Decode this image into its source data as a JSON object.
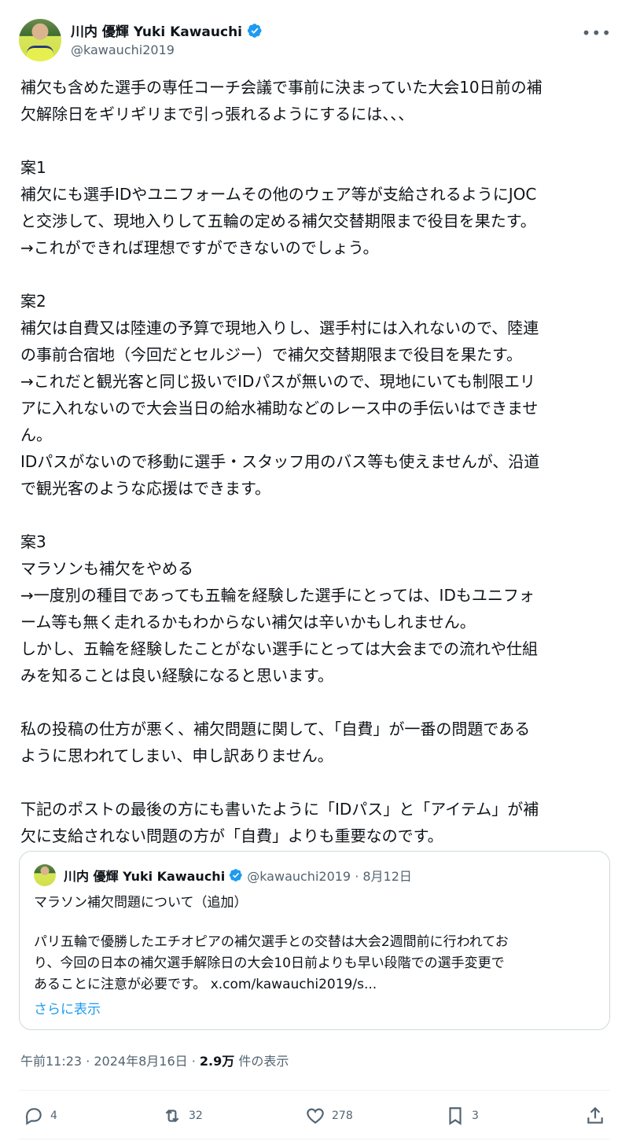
{
  "author": {
    "name": "川内 優輝 Yuki Kawauchi",
    "handle": "@kawauchi2019"
  },
  "post": {
    "text": "補欠も含めた選手の専任コーチ会議で事前に決まっていた大会10日前の補\n欠解除日をギリギリまで引っ張れるようにするには、、、\n\n案1\n補欠にも選手IDやユニフォームその他のウェア等が支給されるようにJOC\nと交渉して、現地入りして五輪の定める補欠交替期限まで役目を果たす。\n→これができれば理想ですができないのでしょう。\n\n案2\n補欠は自費又は陸連の予算で現地入りし、選手村には入れないので、陸連\nの事前合宿地（今回だとセルジー）で補欠交替期限まで役目を果たす。\n→これだと観光客と同じ扱いでIDパスが無いので、現地にいても制限エリ\nアに入れないので大会当日の給水補助などのレース中の手伝いはできませ\nん。\nIDパスがないので移動に選手・スタッフ用のバス等も使えませんが、沿道\nで観光客のような応援はできます。\n\n案3\nマラソンも補欠をやめる\n→一度別の種目であっても五輪を経験した選手にとっては、IDもユニフォ\nーム等も無く走れるかもわからない補欠は辛いかもしれません。\nしかし、五輪を経験したことがない選手にとっては大会までの流れや仕組\nみを知ることは良い経験になると思います。\n\n私の投稿の仕方が悪く、補欠問題に関して、「自費」が一番の問題である\nように思われてしまい、申し訳ありません。\n\n下記のポストの最後の方にも書いたように「IDパス」と「アイテム」が補\n欠に支給されない問題の方が「自費」よりも重要なのです。"
  },
  "quote": {
    "name": "川内 優輝 Yuki Kawauchi",
    "meta": "@kawauchi2019 · 8月12日",
    "title": "マラソン補欠問題について（追加）",
    "text": "パリ五輪で優勝したエチオピアの補欠選手との交替は大会2週間前に行われてお\nり、今回の日本の補欠選手解除日の大会10日前よりも早い段階での選手変更で\nあることに注意が必要です。 x.com/kawauchi2019/s...",
    "show_more": "さらに表示"
  },
  "meta": {
    "time": "午前11:23 · 2024年8月16日 · ",
    "views": "2.9万",
    "views_label": " 件の表示"
  },
  "actions": {
    "replies": "4",
    "reposts": "32",
    "likes": "278",
    "bookmarks": "3"
  },
  "colors": {
    "verified": "#1d9bf0",
    "link": "#1d9bf0",
    "muted": "#536471"
  },
  "icons": [
    "verified-icon",
    "more-icon",
    "reply-icon",
    "repost-icon",
    "like-icon",
    "bookmark-icon",
    "share-icon"
  ]
}
